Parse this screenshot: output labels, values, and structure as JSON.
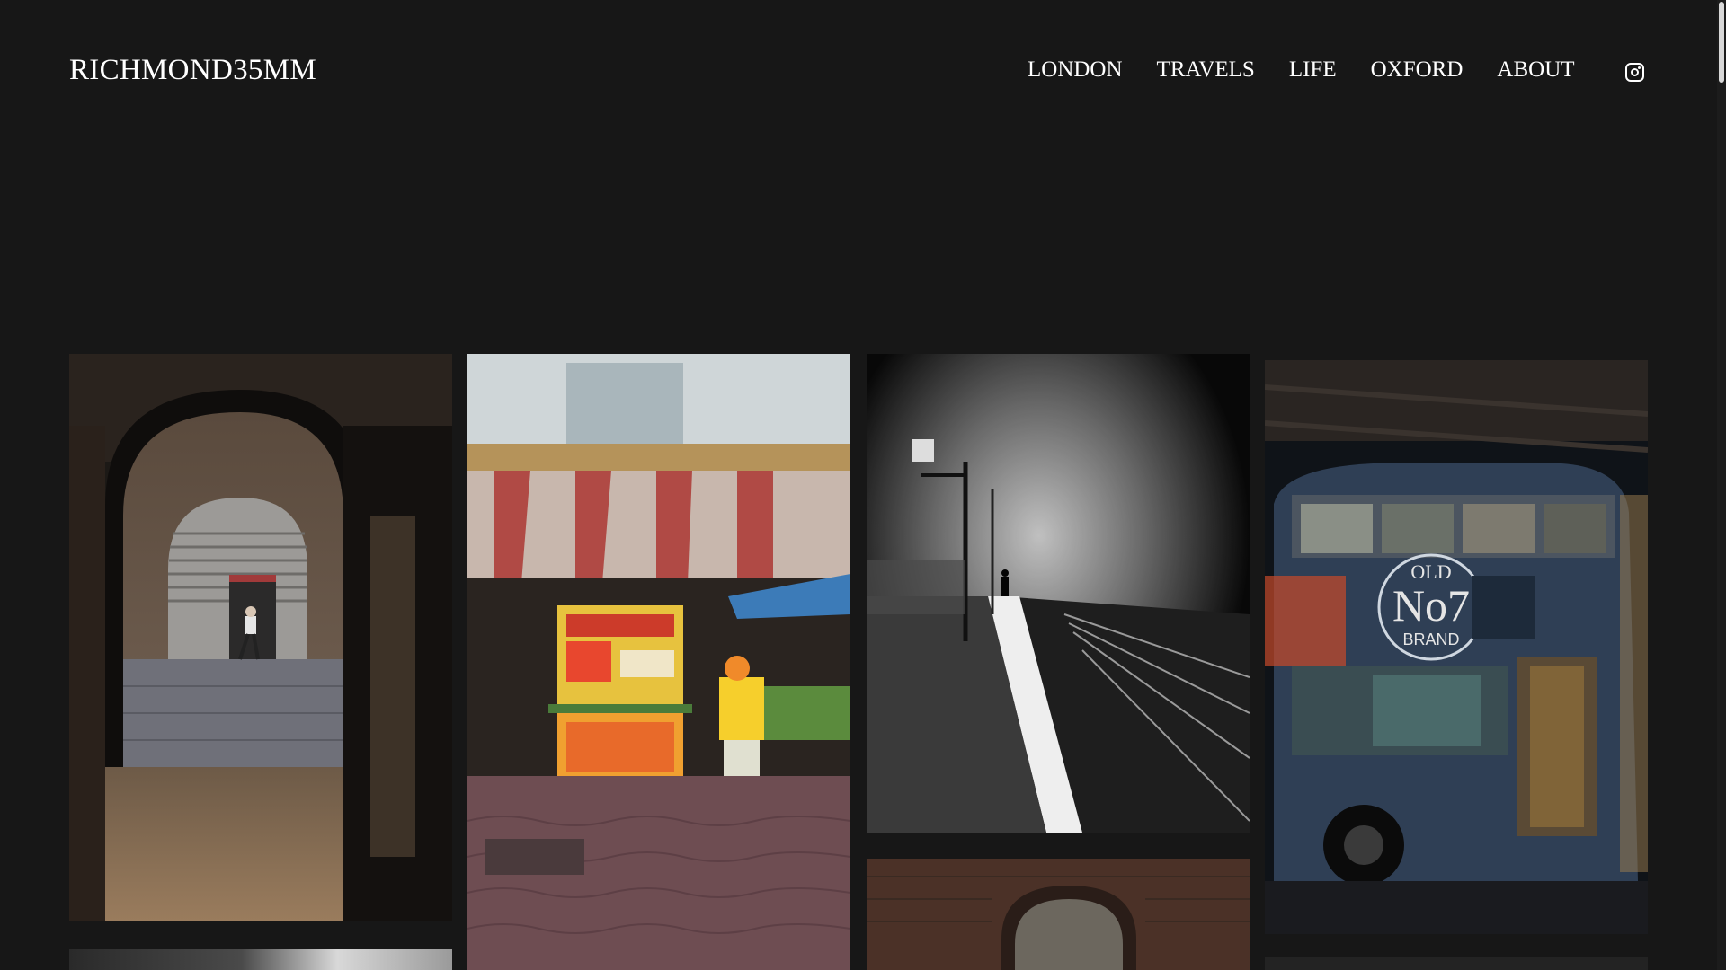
{
  "site": {
    "title": "RICHMOND35MM"
  },
  "nav": {
    "items": [
      {
        "label": "LONDON"
      },
      {
        "label": "TRAVELS"
      },
      {
        "label": "LIFE"
      },
      {
        "label": "OXFORD"
      },
      {
        "label": "ABOUT"
      }
    ],
    "social_icon": "instagram-icon"
  },
  "gallery": {
    "photos": [
      {
        "subject": "brick-archway-walking-man"
      },
      {
        "subject": "thai-street-food-stall"
      },
      {
        "subject": "foggy-train-platform"
      },
      {
        "subject": "night-bus"
      },
      {
        "subject": "brick-arch"
      },
      {
        "subject": "monochrome"
      },
      {
        "subject": "dark"
      }
    ],
    "bus_sign": {
      "line1": "OLD",
      "line2": "No7",
      "line3": "BRAND"
    }
  }
}
